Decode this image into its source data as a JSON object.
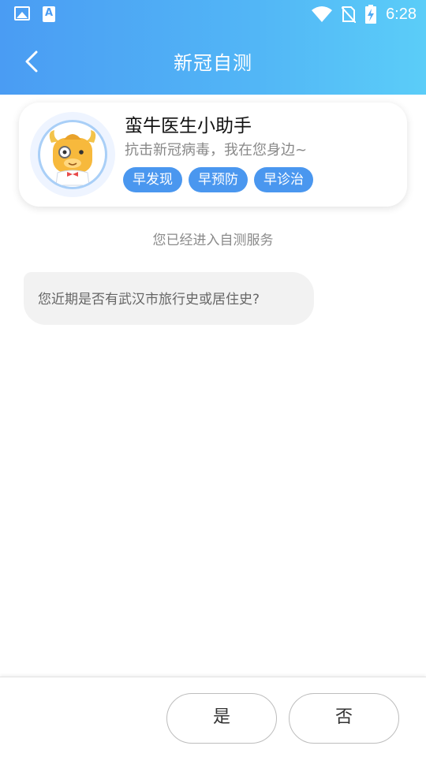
{
  "status_bar": {
    "time": "6:28",
    "icons": [
      "gallery-icon",
      "a-app-icon",
      "wifi-icon",
      "no-sim-icon",
      "battery-charging-icon"
    ]
  },
  "header": {
    "title": "新冠自测",
    "back_icon": "chevron-left-icon"
  },
  "assistant": {
    "name": "蛮牛医生小助手",
    "subtitle": "抗击新冠病毒，我在您身边~",
    "tags": [
      "早发现",
      "早预防",
      "早诊治"
    ]
  },
  "notice": "您已经进入自测服务",
  "messages": [
    {
      "text": "您近期是否有武汉市旅行史或居住史?"
    }
  ],
  "answers": {
    "yes_label": "是",
    "no_label": "否"
  },
  "colors": {
    "header_gradient_start": "#4a9cf3",
    "header_gradient_end": "#5bcdf8",
    "tag_bg": "#4a97ef",
    "bubble_bg": "#f2f2f2"
  }
}
